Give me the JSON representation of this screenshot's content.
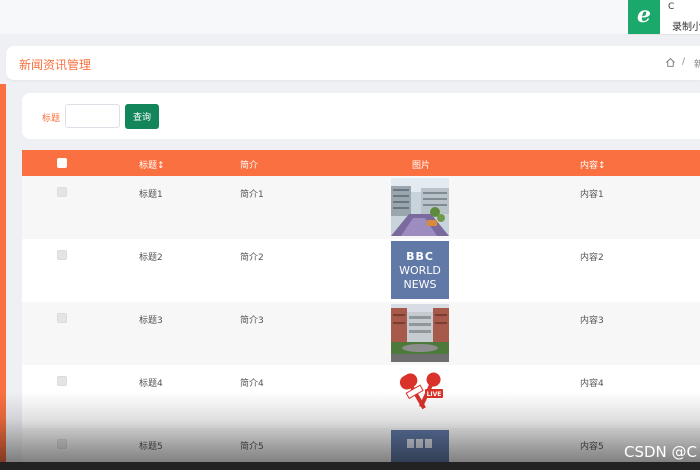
{
  "topbar": {
    "badge_icon_letter": "e",
    "badge_small_text": "C",
    "badge_text": "录制小"
  },
  "header": {
    "title": "新闻资讯管理",
    "breadcrumb_separator": "/",
    "breadcrumb_current": "新"
  },
  "search": {
    "label": "标题",
    "input_value": "",
    "button_label": "查询"
  },
  "table": {
    "columns": [
      "标题↕",
      "简介",
      "图片",
      "内容↕"
    ],
    "rows": [
      {
        "title": "标题1",
        "intro": "简介1",
        "image": "building-photo",
        "content": "内容1"
      },
      {
        "title": "标题2",
        "intro": "简介2",
        "image": "bbc-world-news-logo",
        "content": "内容2",
        "image_text": [
          "BBC",
          "WORLD",
          "NEWS"
        ]
      },
      {
        "title": "标题3",
        "intro": "简介3",
        "image": "campus-photo",
        "content": "内容3"
      },
      {
        "title": "标题4",
        "intro": "简介4",
        "image": "live-microphone-icon",
        "content": "内容4",
        "image_text": [
          "LIVE"
        ]
      },
      {
        "title": "标题5",
        "intro": "简介5",
        "image": "bbc-world-news-logo",
        "content": "内容5"
      }
    ]
  },
  "watermark": "CSDN @C",
  "colors": {
    "accent": "#fb7040",
    "button": "#12865a",
    "badge": "#1aa86b",
    "bbc_blue": "#6179a6"
  }
}
